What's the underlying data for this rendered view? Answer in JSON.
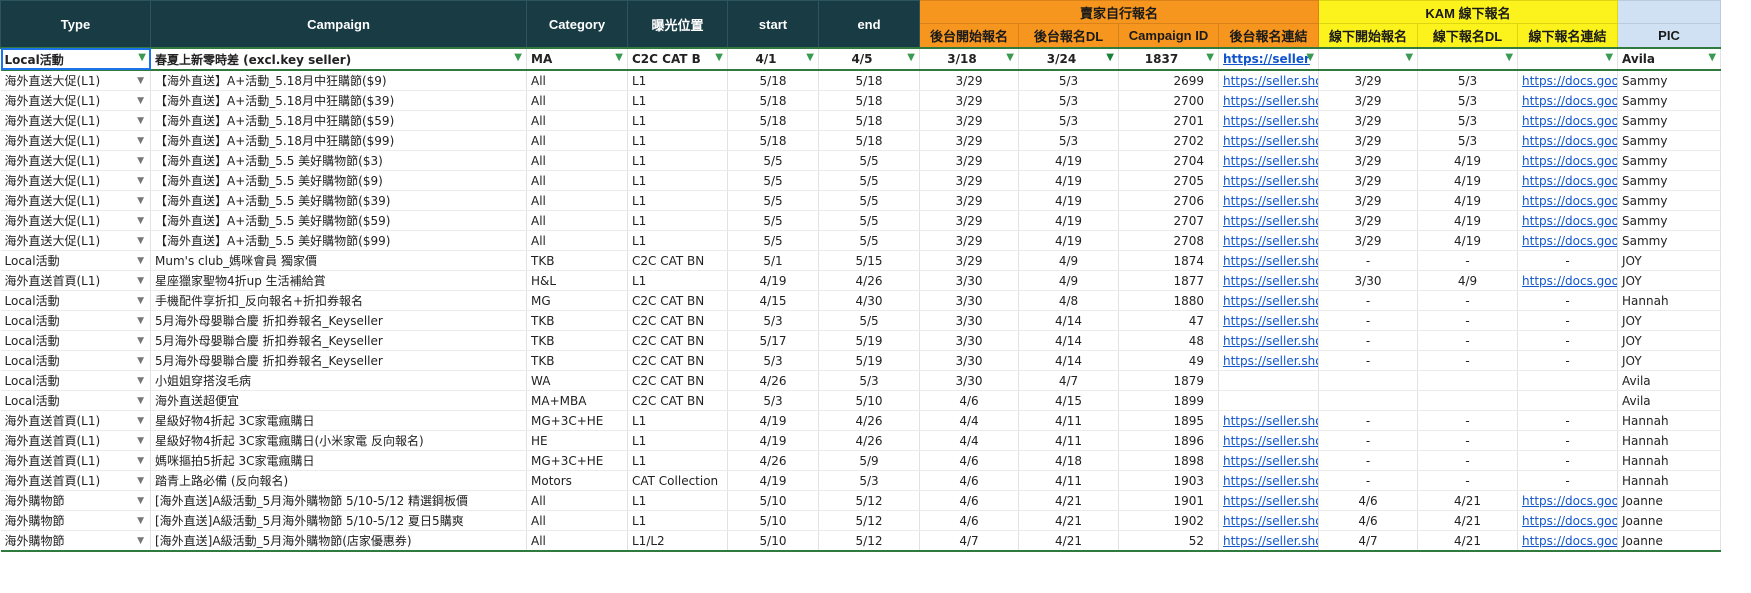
{
  "header": {
    "type": "Type",
    "campaign": "Campaign",
    "category": "Category",
    "exposure": "曝光位置",
    "start": "start",
    "end": "end",
    "seller_group": "賣家自行報名",
    "seller_reg_start": "後台開始報名",
    "seller_reg_dl": "後台報名DL",
    "campaign_id": "Campaign ID",
    "seller_reg_link": "後台報名連結",
    "kam_group": "KAM 線下報名",
    "kam_reg_start": "線下開始報名",
    "kam_reg_dl": "線下報名DL",
    "kam_reg_link": "線下報名連結",
    "pic": "PIC"
  },
  "filter_row": {
    "type": "Local活動",
    "campaign": "春夏上新零時差 (excl.key seller)",
    "category": "MA",
    "exposure": "C2C CAT B",
    "start": "4/1",
    "end": "4/5",
    "seller_reg_start": "3/18",
    "seller_reg_dl": "3/24",
    "campaign_id": "1837",
    "seller_reg_link": "https://seller",
    "kam_reg_start": "",
    "kam_reg_dl": "",
    "kam_reg_link": "",
    "pic": "Avila"
  },
  "rows": [
    {
      "type": "海外直送大促(L1)",
      "campaign": "【海外直送】A+活動_5.18月中狂購節($9)",
      "category": "All",
      "exposure": "L1",
      "start": "5/18",
      "end": "5/18",
      "seller_reg_start": "3/29",
      "seller_reg_dl": "5/3",
      "campaign_id": "2699",
      "seller_reg_link": "https://seller.sho",
      "kam_reg_start": "3/29",
      "kam_reg_dl": "5/3",
      "kam_reg_link": "https://docs.goo",
      "pic": "Sammy"
    },
    {
      "type": "海外直送大促(L1)",
      "campaign": "【海外直送】A+活動_5.18月中狂購節($39)",
      "category": "All",
      "exposure": "L1",
      "start": "5/18",
      "end": "5/18",
      "seller_reg_start": "3/29",
      "seller_reg_dl": "5/3",
      "campaign_id": "2700",
      "seller_reg_link": "https://seller.sho",
      "kam_reg_start": "3/29",
      "kam_reg_dl": "5/3",
      "kam_reg_link": "https://docs.goo",
      "pic": "Sammy"
    },
    {
      "type": "海外直送大促(L1)",
      "campaign": "【海外直送】A+活動_5.18月中狂購節($59)",
      "category": "All",
      "exposure": "L1",
      "start": "5/18",
      "end": "5/18",
      "seller_reg_start": "3/29",
      "seller_reg_dl": "5/3",
      "campaign_id": "2701",
      "seller_reg_link": "https://seller.sho",
      "kam_reg_start": "3/29",
      "kam_reg_dl": "5/3",
      "kam_reg_link": "https://docs.goo",
      "pic": "Sammy"
    },
    {
      "type": "海外直送大促(L1)",
      "campaign": "【海外直送】A+活動_5.18月中狂購節($99)",
      "category": "All",
      "exposure": "L1",
      "start": "5/18",
      "end": "5/18",
      "seller_reg_start": "3/29",
      "seller_reg_dl": "5/3",
      "campaign_id": "2702",
      "seller_reg_link": "https://seller.sho",
      "kam_reg_start": "3/29",
      "kam_reg_dl": "5/3",
      "kam_reg_link": "https://docs.goo",
      "pic": "Sammy"
    },
    {
      "type": "海外直送大促(L1)",
      "campaign": "【海外直送】A+活動_5.5 美好購物節($3)",
      "category": "All",
      "exposure": "L1",
      "start": "5/5",
      "end": "5/5",
      "seller_reg_start": "3/29",
      "seller_reg_dl": "4/19",
      "campaign_id": "2704",
      "seller_reg_link": "https://seller.sho",
      "kam_reg_start": "3/29",
      "kam_reg_dl": "4/19",
      "kam_reg_link": "https://docs.goo",
      "pic": "Sammy"
    },
    {
      "type": "海外直送大促(L1)",
      "campaign": "【海外直送】A+活動_5.5 美好購物節($9)",
      "category": "All",
      "exposure": "L1",
      "start": "5/5",
      "end": "5/5",
      "seller_reg_start": "3/29",
      "seller_reg_dl": "4/19",
      "campaign_id": "2705",
      "seller_reg_link": "https://seller.sho",
      "kam_reg_start": "3/29",
      "kam_reg_dl": "4/19",
      "kam_reg_link": "https://docs.goo",
      "pic": "Sammy"
    },
    {
      "type": "海外直送大促(L1)",
      "campaign": "【海外直送】A+活動_5.5 美好購物節($39)",
      "category": "All",
      "exposure": "L1",
      "start": "5/5",
      "end": "5/5",
      "seller_reg_start": "3/29",
      "seller_reg_dl": "4/19",
      "campaign_id": "2706",
      "seller_reg_link": "https://seller.sho",
      "kam_reg_start": "3/29",
      "kam_reg_dl": "4/19",
      "kam_reg_link": "https://docs.goo",
      "pic": "Sammy"
    },
    {
      "type": "海外直送大促(L1)",
      "campaign": "【海外直送】A+活動_5.5 美好購物節($59)",
      "category": "All",
      "exposure": "L1",
      "start": "5/5",
      "end": "5/5",
      "seller_reg_start": "3/29",
      "seller_reg_dl": "4/19",
      "campaign_id": "2707",
      "seller_reg_link": "https://seller.sho",
      "kam_reg_start": "3/29",
      "kam_reg_dl": "4/19",
      "kam_reg_link": "https://docs.goo",
      "pic": "Sammy"
    },
    {
      "type": "海外直送大促(L1)",
      "campaign": "【海外直送】A+活動_5.5 美好購物節($99)",
      "category": "All",
      "exposure": "L1",
      "start": "5/5",
      "end": "5/5",
      "seller_reg_start": "3/29",
      "seller_reg_dl": "4/19",
      "campaign_id": "2708",
      "seller_reg_link": "https://seller.sho",
      "kam_reg_start": "3/29",
      "kam_reg_dl": "4/19",
      "kam_reg_link": "https://docs.goo",
      "pic": "Sammy"
    },
    {
      "type": "Local活動",
      "campaign": "Mum's club_媽咪會員 獨家價",
      "category": "TKB",
      "exposure": "C2C CAT BN",
      "start": "5/1",
      "end": "5/15",
      "seller_reg_start": "3/29",
      "seller_reg_dl": "4/9",
      "campaign_id": "1874",
      "seller_reg_link": "https://seller.sho",
      "kam_reg_start": "-",
      "kam_reg_dl": "-",
      "kam_reg_link": "-",
      "pic": "JOY"
    },
    {
      "type": "海外直送首頁(L1)",
      "campaign": "星座獵家聖物4折up 生活補給賞",
      "category": "H&L",
      "exposure": "L1",
      "start": "4/19",
      "end": "4/26",
      "seller_reg_start": "3/30",
      "seller_reg_dl": "4/9",
      "campaign_id": "1877",
      "seller_reg_link": "https://seller.sho",
      "kam_reg_start": "3/30",
      "kam_reg_dl": "4/9",
      "kam_reg_link": "https://docs.goo",
      "pic": "JOY"
    },
    {
      "type": "Local活動",
      "campaign": "手機配件享折扣_反向報名+折扣券報名",
      "category": "MG",
      "exposure": "C2C CAT BN",
      "start": "4/15",
      "end": "4/30",
      "seller_reg_start": "3/30",
      "seller_reg_dl": "4/8",
      "campaign_id": "1880",
      "seller_reg_link": "https://seller.sho",
      "kam_reg_start": "-",
      "kam_reg_dl": "-",
      "kam_reg_link": "-",
      "pic": "Hannah"
    },
    {
      "type": "Local活動",
      "campaign": "5月海外母嬰聯合慶 折扣券報名_Keyseller",
      "category": "TKB",
      "exposure": "C2C CAT BN",
      "start": "5/3",
      "end": "5/5",
      "seller_reg_start": "3/30",
      "seller_reg_dl": "4/14",
      "campaign_id": "47",
      "seller_reg_link": "https://seller.sho",
      "kam_reg_start": "-",
      "kam_reg_dl": "-",
      "kam_reg_link": "-",
      "pic": "JOY"
    },
    {
      "type": "Local活動",
      "campaign": "5月海外母嬰聯合慶 折扣券報名_Keyseller",
      "category": "TKB",
      "exposure": "C2C CAT BN",
      "start": "5/17",
      "end": "5/19",
      "seller_reg_start": "3/30",
      "seller_reg_dl": "4/14",
      "campaign_id": "48",
      "seller_reg_link": "https://seller.sho",
      "kam_reg_start": "-",
      "kam_reg_dl": "-",
      "kam_reg_link": "-",
      "pic": "JOY"
    },
    {
      "type": "Local活動",
      "campaign": "5月海外母嬰聯合慶 折扣券報名_Keyseller",
      "category": "TKB",
      "exposure": "C2C CAT BN",
      "start": "5/3",
      "end": "5/19",
      "seller_reg_start": "3/30",
      "seller_reg_dl": "4/14",
      "campaign_id": "49",
      "seller_reg_link": "https://seller.sho",
      "kam_reg_start": "-",
      "kam_reg_dl": "-",
      "kam_reg_link": "-",
      "pic": "JOY"
    },
    {
      "type": "Local活動",
      "campaign": "小姐姐穿搭沒毛病",
      "category": "WA",
      "exposure": "C2C CAT BN",
      "start": "4/26",
      "end": "5/3",
      "seller_reg_start": "3/30",
      "seller_reg_dl": "4/7",
      "campaign_id": "1879",
      "seller_reg_link": "",
      "kam_reg_start": "",
      "kam_reg_dl": "",
      "kam_reg_link": "",
      "pic": "Avila"
    },
    {
      "type": "Local活動",
      "campaign": "海外直送超便宜",
      "category": "MA+MBA",
      "exposure": "C2C CAT BN",
      "start": "5/3",
      "end": "5/10",
      "seller_reg_start": "4/6",
      "seller_reg_dl": "4/15",
      "campaign_id": "1899",
      "seller_reg_link": "",
      "kam_reg_start": "",
      "kam_reg_dl": "",
      "kam_reg_link": "",
      "pic": "Avila"
    },
    {
      "type": "海外直送首頁(L1)",
      "campaign": "星級好物4折起 3C家電瘋購日",
      "category": "MG+3C+HE",
      "exposure": "L1",
      "start": "4/19",
      "end": "4/26",
      "seller_reg_start": "4/4",
      "seller_reg_dl": "4/11",
      "campaign_id": "1895",
      "seller_reg_link": "https://seller.sho",
      "kam_reg_start": "-",
      "kam_reg_dl": "-",
      "kam_reg_link": "-",
      "pic": "Hannah"
    },
    {
      "type": "海外直送首頁(L1)",
      "campaign": "星級好物4折起 3C家電瘋購日(小米家電 反向報名)",
      "category": "HE",
      "exposure": "L1",
      "start": "4/19",
      "end": "4/26",
      "seller_reg_start": "4/4",
      "seller_reg_dl": "4/11",
      "campaign_id": "1896",
      "seller_reg_link": "https://seller.sho",
      "kam_reg_start": "-",
      "kam_reg_dl": "-",
      "kam_reg_link": "-",
      "pic": "Hannah"
    },
    {
      "type": "海外直送首頁(L1)",
      "campaign": "媽咪摳拍5折起 3C家電瘋購日",
      "category": "MG+3C+HE",
      "exposure": "L1",
      "start": "4/26",
      "end": "5/9",
      "seller_reg_start": "4/6",
      "seller_reg_dl": "4/18",
      "campaign_id": "1898",
      "seller_reg_link": "https://seller.sho",
      "kam_reg_start": "-",
      "kam_reg_dl": "-",
      "kam_reg_link": "-",
      "pic": "Hannah"
    },
    {
      "type": "海外直送首頁(L1)",
      "campaign": "踏青上路必備 (反向報名)",
      "category": "Motors",
      "exposure": "CAT Collection",
      "start": "4/19",
      "end": "5/3",
      "seller_reg_start": "4/6",
      "seller_reg_dl": "4/11",
      "campaign_id": "1903",
      "seller_reg_link": "https://seller.sho",
      "kam_reg_start": "-",
      "kam_reg_dl": "-",
      "kam_reg_link": "-",
      "pic": "Hannah"
    },
    {
      "type": "海外購物節",
      "campaign": "[海外直送]A級活動_5月海外購物節 5/10-5/12 精選鋼板價",
      "category": "All",
      "exposure": "L1",
      "start": "5/10",
      "end": "5/12",
      "seller_reg_start": "4/6",
      "seller_reg_dl": "4/21",
      "campaign_id": "1901",
      "seller_reg_link": "https://seller.sho",
      "kam_reg_start": "4/6",
      "kam_reg_dl": "4/21",
      "kam_reg_link": "https://docs.goo",
      "pic": "Joanne"
    },
    {
      "type": "海外購物節",
      "campaign": "[海外直送]A級活動_5月海外購物節 5/10-5/12 夏日5購爽",
      "category": "All",
      "exposure": "L1",
      "start": "5/10",
      "end": "5/12",
      "seller_reg_start": "4/6",
      "seller_reg_dl": "4/21",
      "campaign_id": "1902",
      "seller_reg_link": "https://seller.sho",
      "kam_reg_start": "4/6",
      "kam_reg_dl": "4/21",
      "kam_reg_link": "https://docs.goo",
      "pic": "Joanne"
    },
    {
      "type": "海外購物節",
      "campaign": "[海外直送]A級活動_5月海外購物節(店家優惠券)",
      "category": "All",
      "exposure": "L1/L2",
      "start": "5/10",
      "end": "5/12",
      "seller_reg_start": "4/7",
      "seller_reg_dl": "4/21",
      "campaign_id": "52",
      "seller_reg_link": "https://seller.sho",
      "kam_reg_start": "4/7",
      "kam_reg_dl": "4/21",
      "kam_reg_link": "https://docs.goo",
      "pic": "Joanne"
    }
  ],
  "colors": {
    "header_dark": "#183b44",
    "seller_orange": "#f6961e",
    "kam_yellow": "#fcf31c",
    "pic_lightblue": "#cfe1f3",
    "link": "#1155cc",
    "filter_green": "#2f7a3c"
  },
  "icons": {
    "filter": "filter-icon",
    "filter_active": "filter-active-icon",
    "dropdown": "dropdown-arrow-icon"
  }
}
